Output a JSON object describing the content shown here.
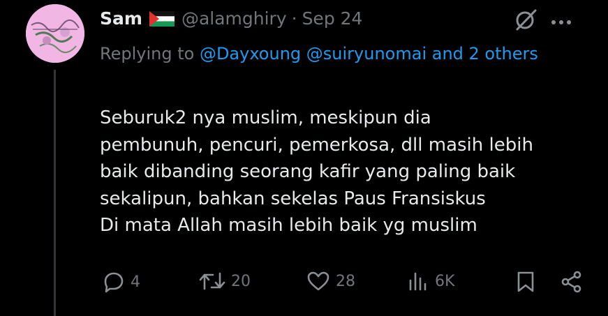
{
  "tweet": {
    "display_name": "Sam",
    "handle": "@alamghiry",
    "separator": "·",
    "date": "Sep 24",
    "replying_prefix": "Replying to",
    "mentions": [
      "@Dayxoung",
      "@suiryunomai"
    ],
    "and_others": "and 2 others",
    "body_lines": [
      "Seburuk2 nya muslim, meskipun dia",
      "pembunuh, pencuri, pemerkosa, dll masih lebih",
      "baik dibanding seorang kafir yang paling baik",
      "sekalipun, bahkan sekelas Paus Fransiskus",
      "Di mata Allah masih lebih baik yg muslim"
    ]
  },
  "actions": {
    "replies": "4",
    "retweets": "20",
    "likes": "28",
    "views": "6K"
  },
  "icons": [
    "avatar",
    "palestine-flag-icon",
    "grok-icon",
    "more-icon",
    "reply-icon",
    "retweet-icon",
    "like-icon",
    "views-icon",
    "bookmark-icon",
    "share-icon"
  ],
  "colors": {
    "background": "#000000",
    "text": "#e7e9ea",
    "muted": "#71767b",
    "link": "#1d9bf0"
  }
}
